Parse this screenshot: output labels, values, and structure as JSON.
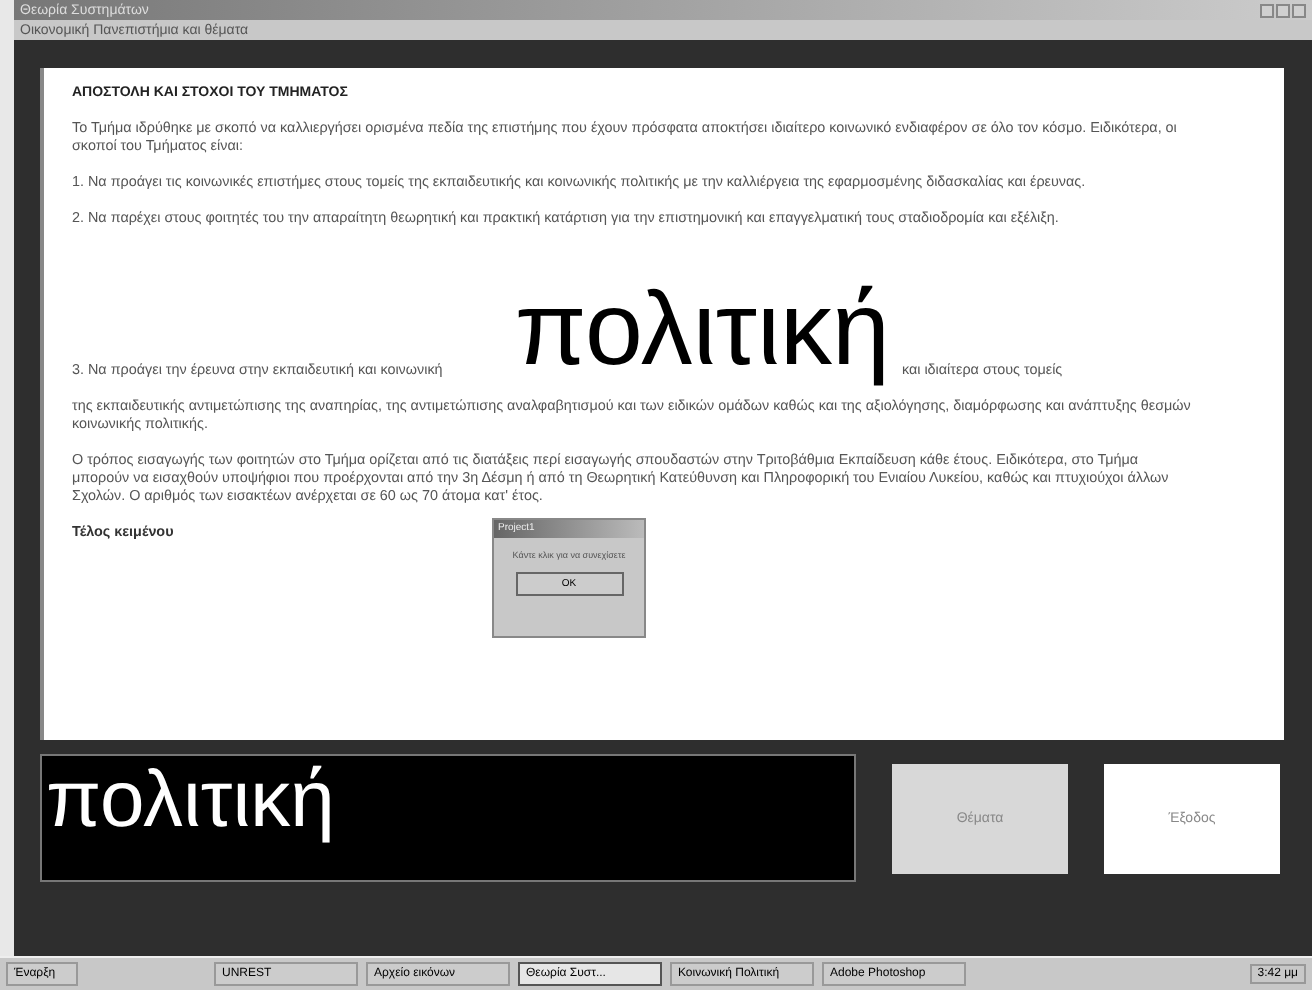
{
  "window": {
    "title": "Θεωρία Συστημάτων",
    "subtitle": "Οικονομική Πανεπιστήμια και θέματα"
  },
  "document": {
    "heading": "ΑΠΟΣΤΟΛΗ ΚΑΙ ΣΤΟΧΟΙ ΤΟΥ ΤΜΗΜΑΤΟΣ",
    "paragraphs": [
      {
        "kind": "text",
        "text": "Το Τμήμα ιδρύθηκε με σκοπό να καλλιεργήσει ορισμένα πεδία της επιστήμης που έχουν πρόσφατα αποκτήσει ιδιαίτερο κοινωνικό ενδιαφέρον σε όλο τον κόσμο. Ειδικότερα, οι σκοποί του Τμήματος είναι:"
      },
      {
        "kind": "text",
        "text": "1. Να προάγει τις κοινωνικές επιστήμες στους τομείς της εκπαιδευτικής και κοινωνικής πολιτικής με την καλλιέργεια της εφαρμοσμένης διδασκαλίας και έρευνας."
      },
      {
        "kind": "text",
        "text": "2. Να παρέχει στους φοιτητές του την απαραίτητη θεωρητική και πρακτική κατάρτιση για την επιστημονική και επαγγελματική τους σταδιοδρομία και εξέλιξη."
      },
      {
        "kind": "highlight",
        "before": "3. Να προάγει την έρευνα στην εκπαιδευτική και κοινωνική",
        "word": "πολιτική",
        "after": "και ιδιαίτερα στους τομείς"
      },
      {
        "kind": "text",
        "text": "της εκπαιδευτικής αντιμετώπισης της αναπηρίας, της αντιμετώπισης αναλφαβητισμού και των ειδικών ομάδων καθώς και της αξιολόγησης, διαμόρφωσης και ανάπτυξης θεσμών κοινωνικής πολιτικής."
      },
      {
        "kind": "text",
        "text": "Ο τρόπος εισαγωγής των φοιτητών στο Τμήμα ορίζεται από τις διατάξεις περί εισαγωγής σπουδαστών στην Τριτοβάθμια Εκπαίδευση κάθε έτους. Ειδικότερα, στο Τμήμα μπορούν να εισαχθούν υποψήφιοι που προέρχονται από την 3η Δέσμη ή από τη Θεωρητική Κατεύθυνση και Πληροφορική του Ενιαίου Λυκείου, καθώς και πτυχιούχοι άλλων Σχολών. Ο αριθμός των εισακτέων ανέρχεται σε 60 ως 70 άτομα κατ' έτος."
      },
      {
        "kind": "bold",
        "text": "Τέλος κειμένου"
      }
    ]
  },
  "dialog": {
    "title": "Project1",
    "message": "Κάντε κλικ για να συνεχίσετε",
    "button": "OK"
  },
  "word_display": "πολιτική",
  "buttons": [
    {
      "label": "Θέματα",
      "selected": true
    },
    {
      "label": "Έξοδος",
      "selected": false
    }
  ],
  "taskbar": {
    "start": "Έναρξη",
    "tasks": [
      {
        "label": "UNREST",
        "selected": false
      },
      {
        "label": "Αρχείο εικόνων",
        "selected": false
      },
      {
        "label": "Θεωρία Συστ...",
        "selected": true
      },
      {
        "label": "Κοινωνική Πολιτική",
        "selected": false
      },
      {
        "label": "Adobe Photoshop",
        "selected": false
      }
    ],
    "clock": "3:42 μμ"
  }
}
